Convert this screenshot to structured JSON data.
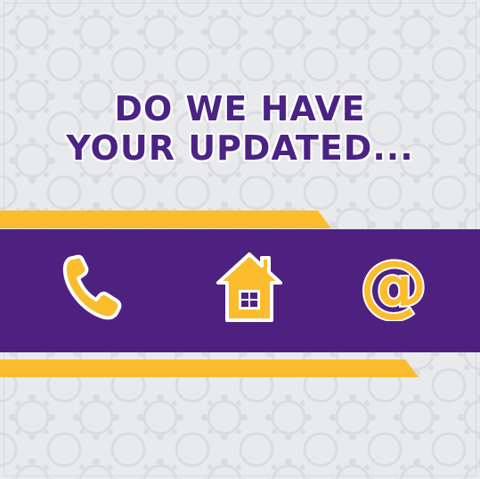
{
  "headline": {
    "line1": "DO WE HAVE",
    "line2": "YOUR UPDATED..."
  },
  "icons": [
    {
      "name": "phone-icon"
    },
    {
      "name": "house-icon"
    },
    {
      "name": "email-at-icon"
    }
  ],
  "colors": {
    "purple": "#4e2181",
    "yellow": "#fbbd2e",
    "background": "#e9eaec"
  }
}
